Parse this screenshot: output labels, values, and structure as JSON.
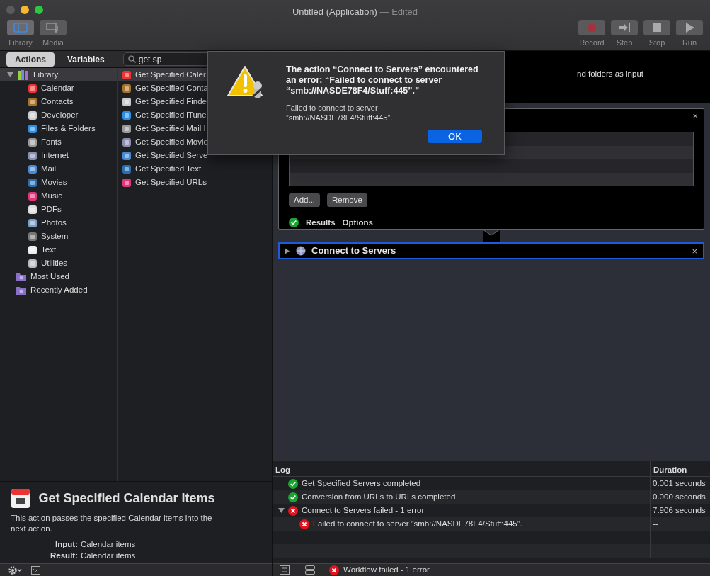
{
  "window": {
    "title": "Untitled (Application)",
    "title_suffix": "— Edited"
  },
  "toolbar": {
    "left": [
      {
        "label": "Library",
        "selected": true
      },
      {
        "label": "Media",
        "selected": false
      }
    ],
    "right": [
      {
        "label": "Record",
        "kind": "record"
      },
      {
        "label": "Step",
        "kind": "step"
      },
      {
        "label": "Stop",
        "kind": "stop"
      },
      {
        "label": "Run",
        "kind": "run"
      }
    ]
  },
  "tabs": [
    {
      "label": "Actions",
      "selected": true
    },
    {
      "label": "Variables",
      "selected": false
    }
  ],
  "search": {
    "value": "get sp"
  },
  "library": {
    "label": "Library",
    "expanded": true,
    "selected": true,
    "children": [
      {
        "label": "Calendar"
      },
      {
        "label": "Contacts"
      },
      {
        "label": "Developer"
      },
      {
        "label": "Files & Folders"
      },
      {
        "label": "Fonts"
      },
      {
        "label": "Internet"
      },
      {
        "label": "Mail"
      },
      {
        "label": "Movies"
      },
      {
        "label": "Music"
      },
      {
        "label": "PDFs"
      },
      {
        "label": "Photos"
      },
      {
        "label": "System"
      },
      {
        "label": "Text"
      },
      {
        "label": "Utilities"
      }
    ]
  },
  "smart_groups": [
    {
      "label": "Most Used"
    },
    {
      "label": "Recently Added"
    }
  ],
  "actions": [
    {
      "label": "Get Specified Caler",
      "selected": true
    },
    {
      "label": "Get Specified Conta",
      "selected": false
    },
    {
      "label": "Get Specified Finde",
      "selected": false
    },
    {
      "label": "Get Specified iTune",
      "selected": false
    },
    {
      "label": "Get Specified Mail I",
      "selected": false
    },
    {
      "label": "Get Specified Movie",
      "selected": false
    },
    {
      "label": "Get Specified Serve",
      "selected": false
    },
    {
      "label": "Get Specified Text",
      "selected": false
    },
    {
      "label": "Get Specified URLs",
      "selected": false
    }
  ],
  "description": {
    "title": "Get Specified Calendar Items",
    "text": "This action passes the specified Calendar items into the next action.",
    "input_label": "Input:",
    "input": "Calendar items",
    "result_label": "Result:",
    "result": "Calendar items"
  },
  "workflow": {
    "top_text": "nd folders as input",
    "card_close": "×",
    "buttons": [
      "Add...",
      "Remove"
    ],
    "card_tabs": [
      "Results",
      "Options"
    ],
    "step": {
      "title": "Connect to Servers",
      "close": "×",
      "expanded": false,
      "selected": true
    }
  },
  "dialog": {
    "title": "The action “Connect to Servers” encountered an error: “Failed to connect to server “smb://NASDE78F4/Stuff:445”.”",
    "message": "Failed to connect to server ”smb://NASDE78F4/Stuff:445”.",
    "button": "OK"
  },
  "log": {
    "columns": [
      "Log",
      "Duration"
    ],
    "rows": [
      {
        "text": "Get Specified Servers completed",
        "kind": "ok",
        "duration": "0.001 seconds"
      },
      {
        "text": "Conversion from URLs to URLs completed",
        "kind": "ok",
        "duration": "0.000 seconds"
      },
      {
        "text": "Connect to Servers failed - 1 error",
        "kind": "error",
        "duration": "7.906 seconds",
        "expanded": true,
        "children": [
          {
            "text": "Failed to connect to server ”smb://NASDE78F4/Stuff:445”.",
            "kind": "error",
            "duration": "--"
          }
        ]
      }
    ]
  },
  "status_bar": {
    "text": "Workflow failed - 1 error",
    "kind": "error"
  }
}
